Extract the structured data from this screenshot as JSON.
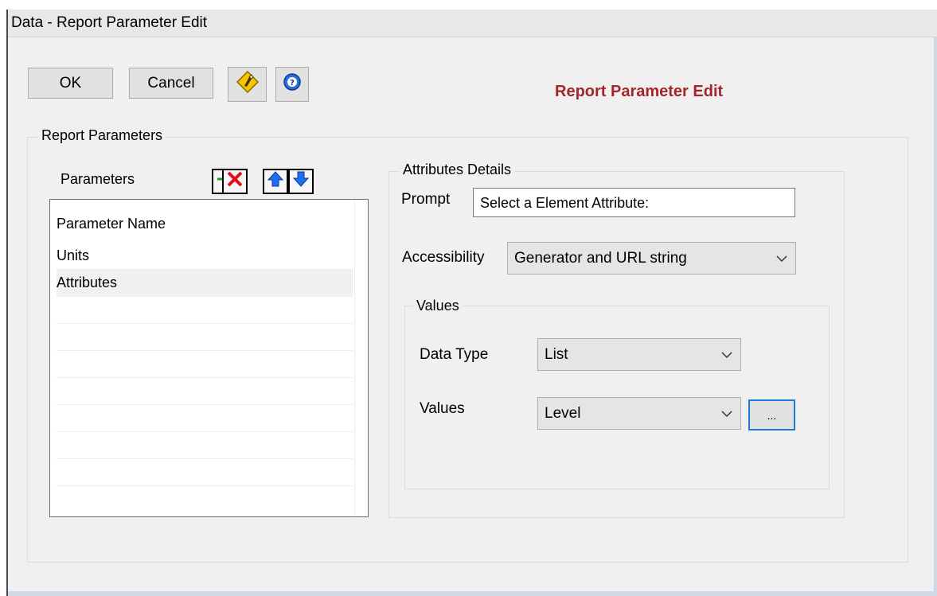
{
  "window": {
    "title": "Data - Report Parameter Edit"
  },
  "toolbar": {
    "ok_label": "OK",
    "cancel_label": "Cancel",
    "icons": [
      "wizard-icon",
      "help-icon"
    ]
  },
  "header": {
    "title": "Report Parameter Edit"
  },
  "report_parameters": {
    "group_label": "Report Parameters",
    "parameters_label": "Parameters",
    "tools": [
      "add-icon",
      "delete-icon",
      "move-up-icon",
      "move-down-icon"
    ],
    "list": {
      "column_header": "Parameter Name",
      "items": [
        "Units",
        "Attributes"
      ],
      "selected": "Attributes"
    }
  },
  "attributes": {
    "group_label": "Attributes Details",
    "prompt_label": "Prompt",
    "prompt_value": "Select a Element Attribute:",
    "accessibility_label": "Accessibility",
    "accessibility_value": "Generator and URL string",
    "values_group_label": "Values",
    "data_type_label": "Data Type",
    "data_type_value": "List",
    "values_label": "Values",
    "values_value": "Level",
    "browse_label": "..."
  },
  "colors": {
    "title_red": "#a2262b",
    "add_green": "#1aa11a",
    "delete_red": "#e0101a",
    "arrow_blue": "#1e6ef0"
  }
}
